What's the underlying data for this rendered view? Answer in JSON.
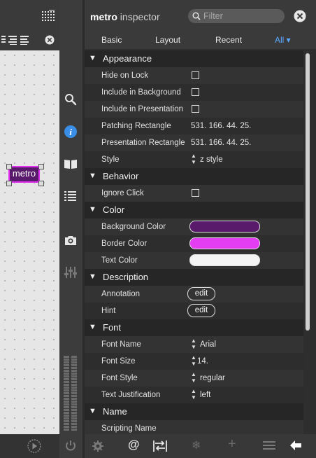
{
  "canvas": {
    "object_label": "metro",
    "object_fill": "#5a1a6c",
    "object_border": "#e030f0"
  },
  "inspector": {
    "title_bold": "metro",
    "title_light": "inspector",
    "filter_placeholder": "Filter",
    "tabs": [
      {
        "label": "Basic"
      },
      {
        "label": "Layout"
      },
      {
        "label": "Recent"
      },
      {
        "label": "All ▾"
      }
    ],
    "active_tab": "All",
    "sections": {
      "appearance": {
        "title": "Appearance",
        "hide_on_lock": "Hide on Lock",
        "include_bg": "Include in Background",
        "include_pres": "Include in Presentation",
        "patching_rect_label": "Patching Rectangle",
        "patching_rect_value": "531. 166. 44. 25.",
        "presentation_rect_label": "Presentation Rectangle",
        "presentation_rect_value": "531. 166. 44. 25.",
        "style_label": "Style",
        "style_value": "z style"
      },
      "behavior": {
        "title": "Behavior",
        "ignore_click": "Ignore Click"
      },
      "color": {
        "title": "Color",
        "bg_label": "Background Color",
        "bg_value": "#5a1a6c",
        "border_label": "Border Color",
        "border_value": "#e43ef2",
        "text_label": "Text Color",
        "text_value": "#f4f4f4"
      },
      "description": {
        "title": "Description",
        "annotation_label": "Annotation",
        "hint_label": "Hint",
        "edit_label": "edit"
      },
      "font": {
        "title": "Font",
        "name_label": "Font Name",
        "name_value": "Arial",
        "size_label": "Font Size",
        "size_value": "14.",
        "style_label": "Font Style",
        "style_value": "regular",
        "just_label": "Text Justification",
        "just_value": "left"
      },
      "name": {
        "title": "Name",
        "scripting_label": "Scripting Name"
      }
    }
  },
  "icons": {
    "sidebar": [
      "search-icon",
      "info-icon",
      "reference-icon",
      "list-icon",
      "snapshot-icon",
      "mixer-icon"
    ],
    "footer": [
      "gear-icon",
      "at-icon",
      "route-icon",
      "freeze-icon",
      "add-icon",
      "menu-icon",
      "back-arrow-icon"
    ]
  },
  "colors": {
    "accent_blue": "#3a8ee6"
  }
}
